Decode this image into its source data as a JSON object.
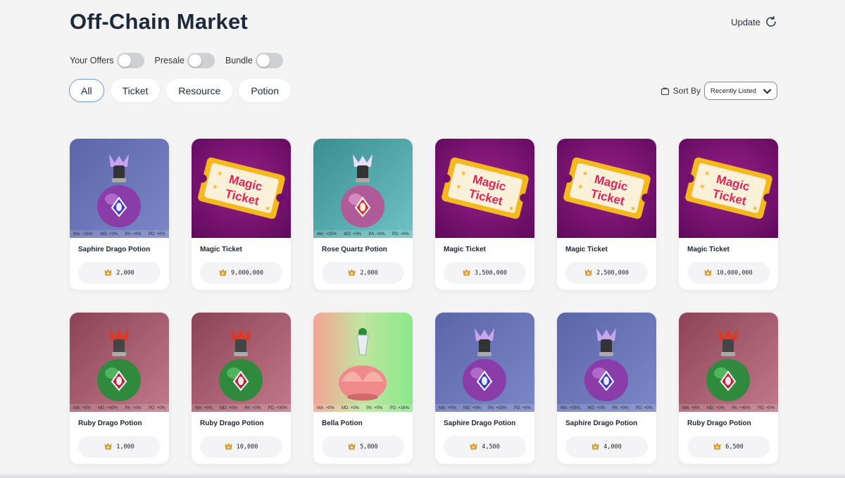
{
  "header": {
    "title": "Off-Chain Market",
    "update_label": "Update"
  },
  "toggles": [
    {
      "label": "Your Offers",
      "on": false
    },
    {
      "label": "Presale",
      "on": false
    },
    {
      "label": "Bundle",
      "on": false
    }
  ],
  "tabs": [
    {
      "label": "All",
      "active": true
    },
    {
      "label": "Ticket",
      "active": false
    },
    {
      "label": "Resource",
      "active": false
    },
    {
      "label": "Potion",
      "active": false
    }
  ],
  "sort": {
    "label": "Sort By",
    "selected": "Recently Listed"
  },
  "items": [
    {
      "name": "Saphire Drago Potion",
      "price": "2,000",
      "kind": "potion",
      "variant": "saphire",
      "stats": [
        "MA: +25%",
        "MD: +0%",
        "PA: +0%",
        "PD: +0%"
      ]
    },
    {
      "name": "Magic Ticket",
      "price": "9,000,000",
      "kind": "ticket",
      "variant": "ticket",
      "stats": []
    },
    {
      "name": "Rose Quartz Potion",
      "price": "2,000",
      "kind": "potion",
      "variant": "rose",
      "stats": [
        "MA: +25%",
        "MD: +0%",
        "PA: +0%",
        "PD: +0%"
      ]
    },
    {
      "name": "Magic Ticket",
      "price": "3,500,000",
      "kind": "ticket",
      "variant": "ticket",
      "stats": []
    },
    {
      "name": "Magic Ticket",
      "price": "2,500,000",
      "kind": "ticket",
      "variant": "ticket",
      "stats": []
    },
    {
      "name": "Magic Ticket",
      "price": "10,000,000",
      "kind": "ticket",
      "variant": "ticket",
      "stats": []
    },
    {
      "name": "Ruby Drago Potion",
      "price": "1,000",
      "kind": "potion",
      "variant": "ruby",
      "stats": [
        "MA: +0%",
        "MD: +40%",
        "PA: +0%",
        "PD: +0%"
      ]
    },
    {
      "name": "Ruby Drago Potion",
      "price": "10,000",
      "kind": "potion",
      "variant": "ruby",
      "stats": [
        "MA: +0%",
        "MD: +0%",
        "PA: +0%",
        "PD: +30%"
      ]
    },
    {
      "name": "Bella Potion",
      "price": "5,000",
      "kind": "potion",
      "variant": "bella",
      "stats": [
        "MA: +0%",
        "MD: +0%",
        "PA: +0%",
        "PD: +16%"
      ]
    },
    {
      "name": "Saphire Drago Potion",
      "price": "4,500",
      "kind": "potion",
      "variant": "saphire",
      "stats": [
        "MA: +0%",
        "MD: +0%",
        "PA: +33%",
        "PD: +0%"
      ]
    },
    {
      "name": "Saphire Drago Potion",
      "price": "4,000",
      "kind": "potion",
      "variant": "saphire",
      "stats": [
        "MA: +35%",
        "MD: +0%",
        "PA: +0%",
        "PD: +0%"
      ]
    },
    {
      "name": "Ruby Drago Potion",
      "price": "6,500",
      "kind": "potion",
      "variant": "ruby",
      "stats": [
        "MA: +0%",
        "MD: +0%",
        "PA: +40%",
        "PD: +0%"
      ]
    }
  ],
  "ticket_art": {
    "line1": "Magic",
    "line2": "Ticket"
  },
  "colors": {
    "accent": "#6b9bd9",
    "title": "#1e2a3b",
    "ticket_bg": "#7a1476",
    "ticket_text": "#e0255a",
    "ticket_frame": "#f5b81e"
  },
  "icons": {
    "update": "refresh-icon",
    "sort": "cart-icon",
    "select": "chevron-down-icon",
    "price": "coin-icon"
  }
}
